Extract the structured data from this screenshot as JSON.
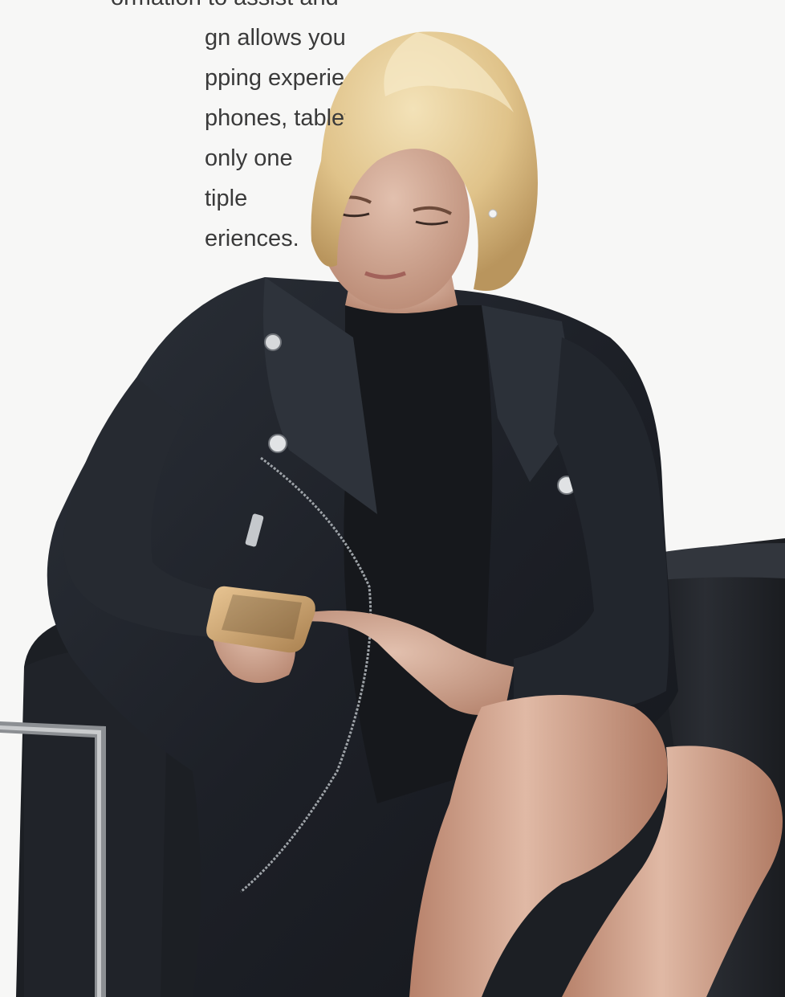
{
  "copy": {
    "lines": [
      "ormation to assist and",
      "gn allows you to",
      "pping experiences",
      "phones, tablets,",
      "only one",
      "tiple",
      "eriences."
    ]
  },
  "palette": {
    "background": "#f7f7f6",
    "text": "#3a3a3a",
    "jacket": "#23262b",
    "sofa": "#1c1f24",
    "hair": "#e8cf9a",
    "skin": "#c99a82"
  }
}
